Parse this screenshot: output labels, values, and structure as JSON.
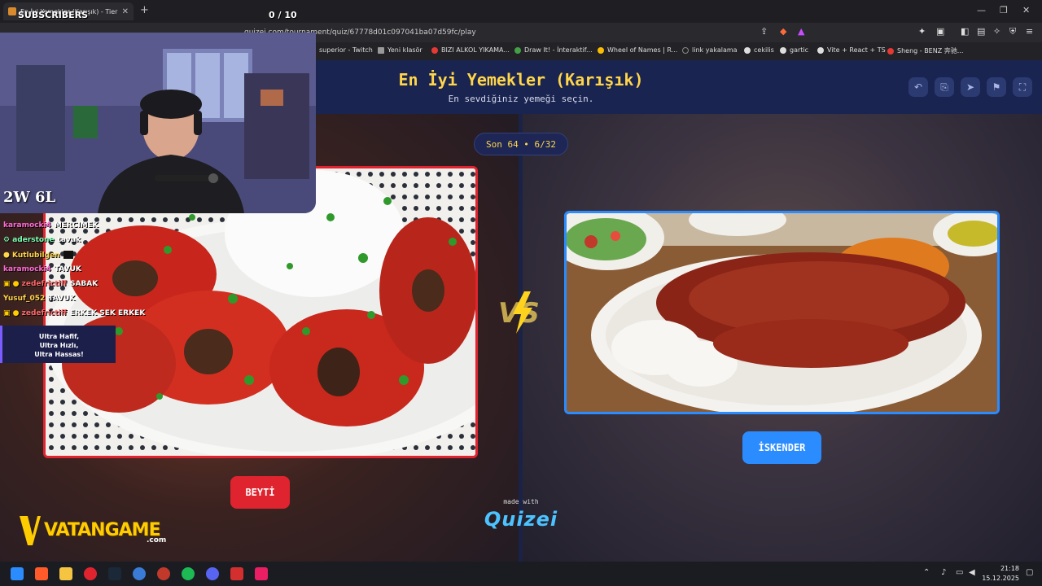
{
  "browser": {
    "tab_title": "En İyi Yemekler (Karışık) - Tier Li",
    "tab_close": "✕",
    "new_tab": "+",
    "url": "quizei.com/tournament/quiz/67778d01c097041ba07d59fc/play",
    "window_controls": [
      "—",
      "❐",
      "✕"
    ],
    "bookmarks": [
      {
        "label": "superior - Twitch",
        "color": "#9146ff"
      },
      {
        "label": "Yeni klasör",
        "color": "#999999"
      },
      {
        "label": "BIZI ALKOL YIKAMA...",
        "color": "#e53935"
      },
      {
        "label": "Draw It! - İnteraktif...",
        "color": "#43a047"
      },
      {
        "label": "Wheel of Names | R...",
        "color": "#fbbc04"
      },
      {
        "label": "link yakalama",
        "color": "#222222"
      },
      {
        "label": "cekilis",
        "color": "#dddddd"
      },
      {
        "label": "gartic",
        "color": "#dddddd"
      },
      {
        "label": "Vite + React + TS",
        "color": "#dddddd"
      },
      {
        "label": "Sheng - BENZ 奔驰...",
        "color": "#e53935"
      }
    ]
  },
  "stream": {
    "subscribers_label": "SUBSCRIBERS",
    "subscribers_count": "0  / 10",
    "record": "2W 6L",
    "chat": [
      {
        "user": "karamocki4",
        "msg": "MERCIMEK",
        "color": "#ff6ad5"
      },
      {
        "user": "aderstone",
        "msg": "tavuk",
        "color": "#7cffb2"
      },
      {
        "user": "Kutlubilgen",
        "msg": "",
        "color": "#ffd54a"
      },
      {
        "user": "karamocki4",
        "msg": "TAVUK",
        "color": "#ff6ad5"
      },
      {
        "user": "zedefrictiff",
        "msg": "SABAK",
        "color": "#ff6a6a"
      },
      {
        "user": "Yusuf_052",
        "msg": "TAVUK",
        "color": "#ffd54a"
      },
      {
        "user": "zedefrictiff",
        "msg": "ERKEK SEK ERKEK",
        "color": "#ff6a6a"
      }
    ],
    "ad_lines": [
      "Ultra Hafif,",
      "Ultra Hızlı,",
      "Ultra Hassas!"
    ],
    "sponsor": "VATANGAME",
    "sponsor_suffix": ".com"
  },
  "quiz": {
    "title": "En İyi Yemekler (Karışık)",
    "subtitle": "En sevdiğiniz yemeği seçin.",
    "round": "Son 64 • 6/32",
    "left_choice": "BEYTİ",
    "right_choice": "İSKENDER",
    "vs_text": "VS",
    "made_with": "made with",
    "brand": "Quizei",
    "header_icons": [
      "undo-icon",
      "share-icon",
      "send-icon",
      "flag-icon",
      "fullscreen-icon"
    ],
    "accent_left": "#e0242f",
    "accent_right": "#2b8cff",
    "title_color": "#ffd54a"
  },
  "taskbar": {
    "time": "21:18",
    "date": "15.12.2025"
  }
}
